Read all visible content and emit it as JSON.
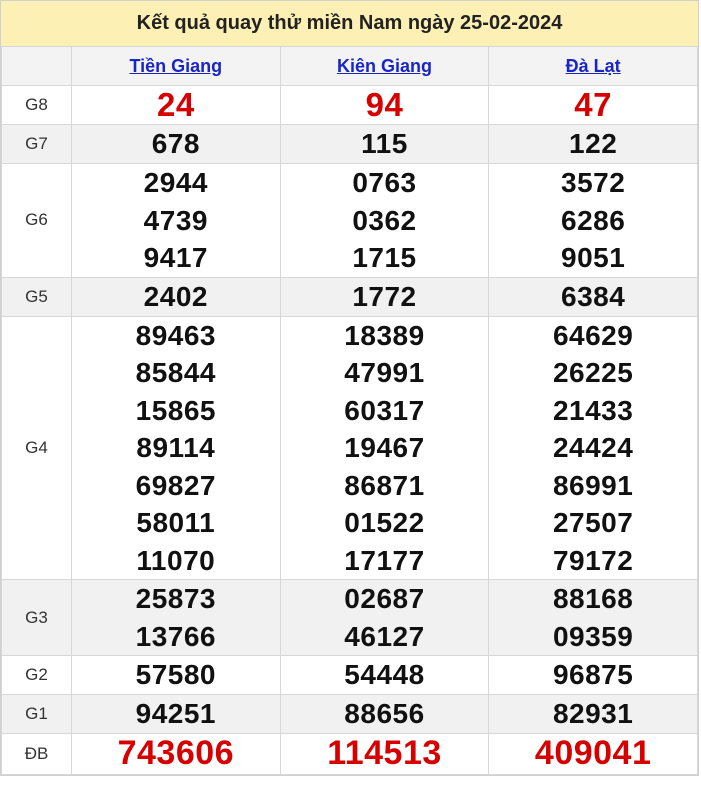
{
  "title": "Kết quả quay thử miền Nam ngày 25-02-2024",
  "provinces": [
    "Tiền Giang",
    "Kiên Giang",
    "Đà Lạt"
  ],
  "prizes": [
    {
      "label": "G8",
      "values": [
        [
          "24"
        ],
        [
          "94"
        ],
        [
          "47"
        ]
      ]
    },
    {
      "label": "G7",
      "values": [
        [
          "678"
        ],
        [
          "115"
        ],
        [
          "122"
        ]
      ]
    },
    {
      "label": "G6",
      "values": [
        [
          "2944",
          "4739",
          "9417"
        ],
        [
          "0763",
          "0362",
          "1715"
        ],
        [
          "3572",
          "6286",
          "9051"
        ]
      ]
    },
    {
      "label": "G5",
      "values": [
        [
          "2402"
        ],
        [
          "1772"
        ],
        [
          "6384"
        ]
      ]
    },
    {
      "label": "G4",
      "values": [
        [
          "89463",
          "85844",
          "15865",
          "89114",
          "69827",
          "58011",
          "11070"
        ],
        [
          "18389",
          "47991",
          "60317",
          "19467",
          "86871",
          "01522",
          "17177"
        ],
        [
          "64629",
          "26225",
          "21433",
          "24424",
          "86991",
          "27507",
          "79172"
        ]
      ]
    },
    {
      "label": "G3",
      "values": [
        [
          "25873",
          "13766"
        ],
        [
          "02687",
          "46127"
        ],
        [
          "88168",
          "09359"
        ]
      ]
    },
    {
      "label": "G2",
      "values": [
        [
          "57580"
        ],
        [
          "54448"
        ],
        [
          "96875"
        ]
      ]
    },
    {
      "label": "G1",
      "values": [
        [
          "94251"
        ],
        [
          "88656"
        ],
        [
          "82931"
        ]
      ]
    },
    {
      "label": "ĐB",
      "values": [
        [
          "743606"
        ],
        [
          "114513"
        ],
        [
          "409041"
        ]
      ]
    }
  ],
  "colors": {
    "title_bg": "#fcf0b4",
    "link": "#1a25c9",
    "highlight": "#d60000"
  }
}
